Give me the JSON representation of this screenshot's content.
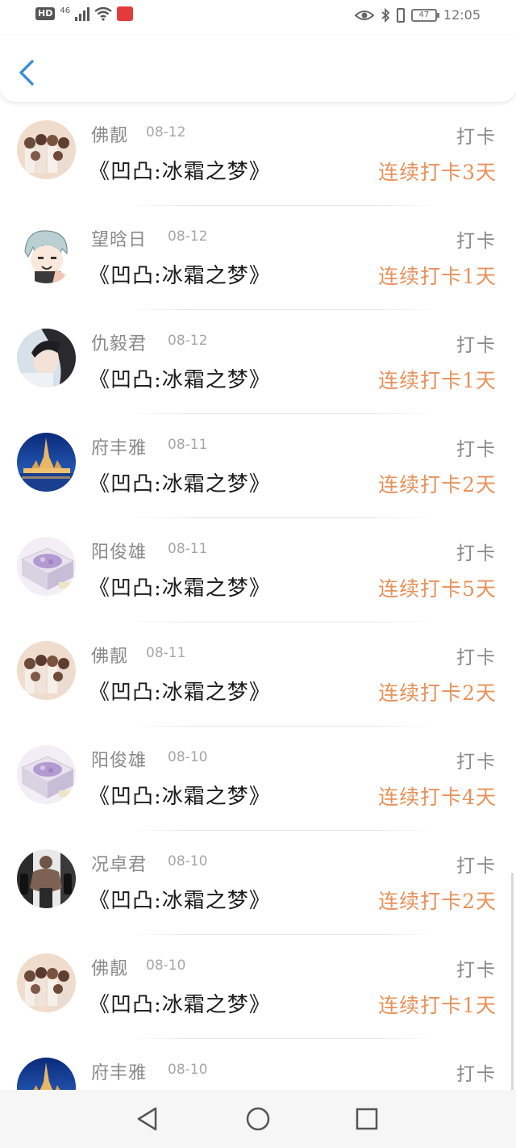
{
  "status_bar": {
    "hd": "HD",
    "network": "46",
    "battery": "47",
    "time": "12:05"
  },
  "header": {
    "back_icon": "chevron-left-icon",
    "accent_color": "#3a8fd6"
  },
  "feed": {
    "items": [
      {
        "user": "佛靓",
        "date": "08-12",
        "book": "《凹凸:冰霜之梦》",
        "action": "打卡",
        "streak": "连续打卡3天",
        "avatar": "group-photo"
      },
      {
        "user": "望晗日",
        "date": "08-12",
        "book": "《凹凸:冰霜之梦》",
        "action": "打卡",
        "streak": "连续打卡1天",
        "avatar": "anime-character"
      },
      {
        "user": "仇毅君",
        "date": "08-12",
        "book": "《凹凸:冰霜之梦》",
        "action": "打卡",
        "streak": "连续打卡1天",
        "avatar": "portrait-photo"
      },
      {
        "user": "府丰雅",
        "date": "08-11",
        "book": "《凹凸:冰霜之梦》",
        "action": "打卡",
        "streak": "连续打卡2天",
        "avatar": "temple-night"
      },
      {
        "user": "阳俊雄",
        "date": "08-11",
        "book": "《凹凸:冰霜之梦》",
        "action": "打卡",
        "streak": "连续打卡5天",
        "avatar": "lavender-box"
      },
      {
        "user": "佛靓",
        "date": "08-11",
        "book": "《凹凸:冰霜之梦》",
        "action": "打卡",
        "streak": "连续打卡2天",
        "avatar": "group-photo"
      },
      {
        "user": "阳俊雄",
        "date": "08-10",
        "book": "《凹凸:冰霜之梦》",
        "action": "打卡",
        "streak": "连续打卡4天",
        "avatar": "lavender-box"
      },
      {
        "user": "况卓君",
        "date": "08-10",
        "book": "《凹凸:冰霜之梦》",
        "action": "打卡",
        "streak": "连续打卡2天",
        "avatar": "bodybuilder"
      },
      {
        "user": "佛靓",
        "date": "08-10",
        "book": "《凹凸:冰霜之梦》",
        "action": "打卡",
        "streak": "连续打卡1天",
        "avatar": "group-photo"
      },
      {
        "user": "府丰雅",
        "date": "08-10",
        "book": "",
        "action": "打卡",
        "streak": "",
        "avatar": "temple-night"
      }
    ],
    "streak_color": "#e8915a"
  },
  "nav": {
    "back_icon": "triangle-back-icon",
    "home_icon": "circle-home-icon",
    "recents_icon": "square-recents-icon"
  }
}
